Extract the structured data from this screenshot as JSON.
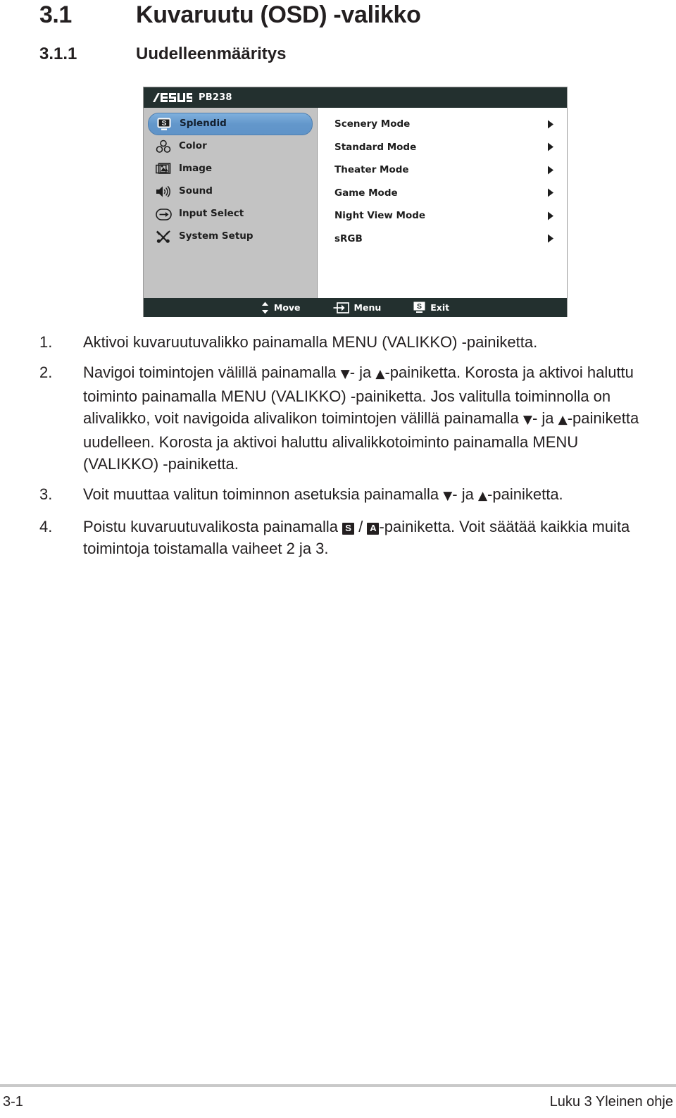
{
  "headings": {
    "section_number": "3.1",
    "section_title": "Kuvaruutu (OSD) -valikko",
    "subsection_number": "3.1.1",
    "subsection_title": "Uudelleenmääritys"
  },
  "osd": {
    "brand": "ASUS",
    "model": "PB238",
    "sidebar_items": [
      {
        "label": "Splendid",
        "icon": "splendid-monitor-icon",
        "selected": true
      },
      {
        "label": "Color",
        "icon": "color-droplets-icon",
        "selected": false
      },
      {
        "label": "Image",
        "icon": "image-picture-icon",
        "selected": false
      },
      {
        "label": "Sound",
        "icon": "sound-speaker-icon",
        "selected": false
      },
      {
        "label": "Input Select",
        "icon": "input-arrow-icon",
        "selected": false
      },
      {
        "label": "System Setup",
        "icon": "system-tools-icon",
        "selected": false
      }
    ],
    "main_items": [
      {
        "label": "Scenery Mode",
        "arrow": "chevron-right-icon"
      },
      {
        "label": "Standard Mode",
        "arrow": "chevron-right-icon"
      },
      {
        "label": "Theater Mode",
        "arrow": "chevron-right-icon"
      },
      {
        "label": "Game Mode",
        "arrow": "chevron-right-icon"
      },
      {
        "label": "Night View Mode",
        "arrow": "chevron-right-icon"
      },
      {
        "label": "sRGB",
        "arrow": "chevron-right-icon"
      }
    ],
    "footer_items": [
      {
        "label": "Move",
        "icon": "up-down-arrows-icon"
      },
      {
        "label": "Menu",
        "icon": "menu-enter-icon"
      },
      {
        "label": "Exit",
        "icon": "splendid-s-key-icon"
      }
    ],
    "colors": {
      "titlebar": "#23302f",
      "sidebar": "#c3c3c3",
      "selection": "#6397cb",
      "panel": "#ffffff"
    }
  },
  "steps": [
    {
      "number": "1.",
      "parts": [
        {
          "t": "text",
          "v": "Aktivoi kuvaruutuvalikko painamalla MENU (VALIKKO) -painiketta."
        }
      ]
    },
    {
      "number": "2.",
      "parts": [
        {
          "t": "text",
          "v": "Navigoi toimintojen välillä painamalla "
        },
        {
          "t": "glyph",
          "v": "▼"
        },
        {
          "t": "text",
          "v": "- ja "
        },
        {
          "t": "glyph",
          "v": "▲"
        },
        {
          "t": "text",
          "v": "-painiketta. Korosta ja aktivoi haluttu toiminto painamalla MENU (VALIKKO) -painiketta. Jos valitulla toiminnolla on alivalikko, voit navigoida alivalikon toimintojen välillä painamalla "
        },
        {
          "t": "glyph",
          "v": "▼"
        },
        {
          "t": "text",
          "v": "- ja "
        },
        {
          "t": "glyph",
          "v": "▲"
        },
        {
          "t": "text",
          "v": "-painiketta uudelleen. Korosta ja aktivoi haluttu alivalikkotoiminto painamalla MENU (VALIKKO) -painiketta."
        }
      ]
    },
    {
      "number": "3.",
      "parts": [
        {
          "t": "text",
          "v": "Voit muuttaa valitun toiminnon asetuksia painamalla "
        },
        {
          "t": "glyph",
          "v": "▼"
        },
        {
          "t": "text",
          "v": "- ja "
        },
        {
          "t": "glyph",
          "v": "▲"
        },
        {
          "t": "text",
          "v": "-painiketta."
        }
      ]
    },
    {
      "number": "4.",
      "parts": [
        {
          "t": "text",
          "v": "Poistu kuvaruutuvalikosta painamalla "
        },
        {
          "t": "key",
          "v": "S"
        },
        {
          "t": "text",
          "v": " / "
        },
        {
          "t": "key",
          "v": "A"
        },
        {
          "t": "text",
          "v": "-painiketta. Voit säätää kaikkia muita toimintoja toistamalla vaiheet 2 ja 3."
        }
      ]
    }
  ],
  "page_footer": {
    "left": "3-1",
    "right": "Luku 3 Yleinen ohje"
  }
}
